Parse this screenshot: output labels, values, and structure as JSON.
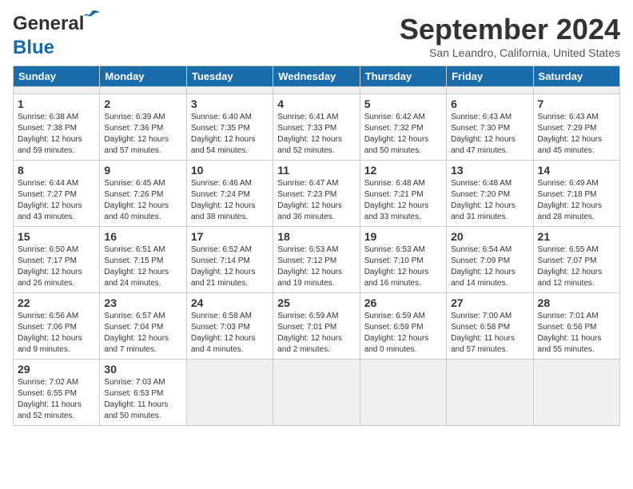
{
  "header": {
    "logo_general": "General",
    "logo_blue": "Blue",
    "month_title": "September 2024",
    "location": "San Leandro, California, United States"
  },
  "calendar": {
    "days_of_week": [
      "Sunday",
      "Monday",
      "Tuesday",
      "Wednesday",
      "Thursday",
      "Friday",
      "Saturday"
    ],
    "weeks": [
      [
        {
          "day": "",
          "empty": true
        },
        {
          "day": "",
          "empty": true
        },
        {
          "day": "",
          "empty": true
        },
        {
          "day": "",
          "empty": true
        },
        {
          "day": "",
          "empty": true
        },
        {
          "day": "",
          "empty": true
        },
        {
          "day": "",
          "empty": true
        }
      ],
      [
        {
          "day": "1",
          "info": "Sunrise: 6:38 AM\nSunset: 7:38 PM\nDaylight: 12 hours\nand 59 minutes."
        },
        {
          "day": "2",
          "info": "Sunrise: 6:39 AM\nSunset: 7:36 PM\nDaylight: 12 hours\nand 57 minutes."
        },
        {
          "day": "3",
          "info": "Sunrise: 6:40 AM\nSunset: 7:35 PM\nDaylight: 12 hours\nand 54 minutes."
        },
        {
          "day": "4",
          "info": "Sunrise: 6:41 AM\nSunset: 7:33 PM\nDaylight: 12 hours\nand 52 minutes."
        },
        {
          "day": "5",
          "info": "Sunrise: 6:42 AM\nSunset: 7:32 PM\nDaylight: 12 hours\nand 50 minutes."
        },
        {
          "day": "6",
          "info": "Sunrise: 6:43 AM\nSunset: 7:30 PM\nDaylight: 12 hours\nand 47 minutes."
        },
        {
          "day": "7",
          "info": "Sunrise: 6:43 AM\nSunset: 7:29 PM\nDaylight: 12 hours\nand 45 minutes."
        }
      ],
      [
        {
          "day": "8",
          "info": "Sunrise: 6:44 AM\nSunset: 7:27 PM\nDaylight: 12 hours\nand 43 minutes."
        },
        {
          "day": "9",
          "info": "Sunrise: 6:45 AM\nSunset: 7:26 PM\nDaylight: 12 hours\nand 40 minutes."
        },
        {
          "day": "10",
          "info": "Sunrise: 6:46 AM\nSunset: 7:24 PM\nDaylight: 12 hours\nand 38 minutes."
        },
        {
          "day": "11",
          "info": "Sunrise: 6:47 AM\nSunset: 7:23 PM\nDaylight: 12 hours\nand 36 minutes."
        },
        {
          "day": "12",
          "info": "Sunrise: 6:48 AM\nSunset: 7:21 PM\nDaylight: 12 hours\nand 33 minutes."
        },
        {
          "day": "13",
          "info": "Sunrise: 6:48 AM\nSunset: 7:20 PM\nDaylight: 12 hours\nand 31 minutes."
        },
        {
          "day": "14",
          "info": "Sunrise: 6:49 AM\nSunset: 7:18 PM\nDaylight: 12 hours\nand 28 minutes."
        }
      ],
      [
        {
          "day": "15",
          "info": "Sunrise: 6:50 AM\nSunset: 7:17 PM\nDaylight: 12 hours\nand 26 minutes."
        },
        {
          "day": "16",
          "info": "Sunrise: 6:51 AM\nSunset: 7:15 PM\nDaylight: 12 hours\nand 24 minutes."
        },
        {
          "day": "17",
          "info": "Sunrise: 6:52 AM\nSunset: 7:14 PM\nDaylight: 12 hours\nand 21 minutes."
        },
        {
          "day": "18",
          "info": "Sunrise: 6:53 AM\nSunset: 7:12 PM\nDaylight: 12 hours\nand 19 minutes."
        },
        {
          "day": "19",
          "info": "Sunrise: 6:53 AM\nSunset: 7:10 PM\nDaylight: 12 hours\nand 16 minutes."
        },
        {
          "day": "20",
          "info": "Sunrise: 6:54 AM\nSunset: 7:09 PM\nDaylight: 12 hours\nand 14 minutes."
        },
        {
          "day": "21",
          "info": "Sunrise: 6:55 AM\nSunset: 7:07 PM\nDaylight: 12 hours\nand 12 minutes."
        }
      ],
      [
        {
          "day": "22",
          "info": "Sunrise: 6:56 AM\nSunset: 7:06 PM\nDaylight: 12 hours\nand 9 minutes."
        },
        {
          "day": "23",
          "info": "Sunrise: 6:57 AM\nSunset: 7:04 PM\nDaylight: 12 hours\nand 7 minutes."
        },
        {
          "day": "24",
          "info": "Sunrise: 6:58 AM\nSunset: 7:03 PM\nDaylight: 12 hours\nand 4 minutes."
        },
        {
          "day": "25",
          "info": "Sunrise: 6:59 AM\nSunset: 7:01 PM\nDaylight: 12 hours\nand 2 minutes."
        },
        {
          "day": "26",
          "info": "Sunrise: 6:59 AM\nSunset: 6:59 PM\nDaylight: 12 hours\nand 0 minutes."
        },
        {
          "day": "27",
          "info": "Sunrise: 7:00 AM\nSunset: 6:58 PM\nDaylight: 11 hours\nand 57 minutes."
        },
        {
          "day": "28",
          "info": "Sunrise: 7:01 AM\nSunset: 6:56 PM\nDaylight: 11 hours\nand 55 minutes."
        }
      ],
      [
        {
          "day": "29",
          "info": "Sunrise: 7:02 AM\nSunset: 6:55 PM\nDaylight: 11 hours\nand 52 minutes."
        },
        {
          "day": "30",
          "info": "Sunrise: 7:03 AM\nSunset: 6:53 PM\nDaylight: 11 hours\nand 50 minutes."
        },
        {
          "day": "",
          "empty": true
        },
        {
          "day": "",
          "empty": true
        },
        {
          "day": "",
          "empty": true
        },
        {
          "day": "",
          "empty": true
        },
        {
          "day": "",
          "empty": true
        }
      ]
    ]
  }
}
